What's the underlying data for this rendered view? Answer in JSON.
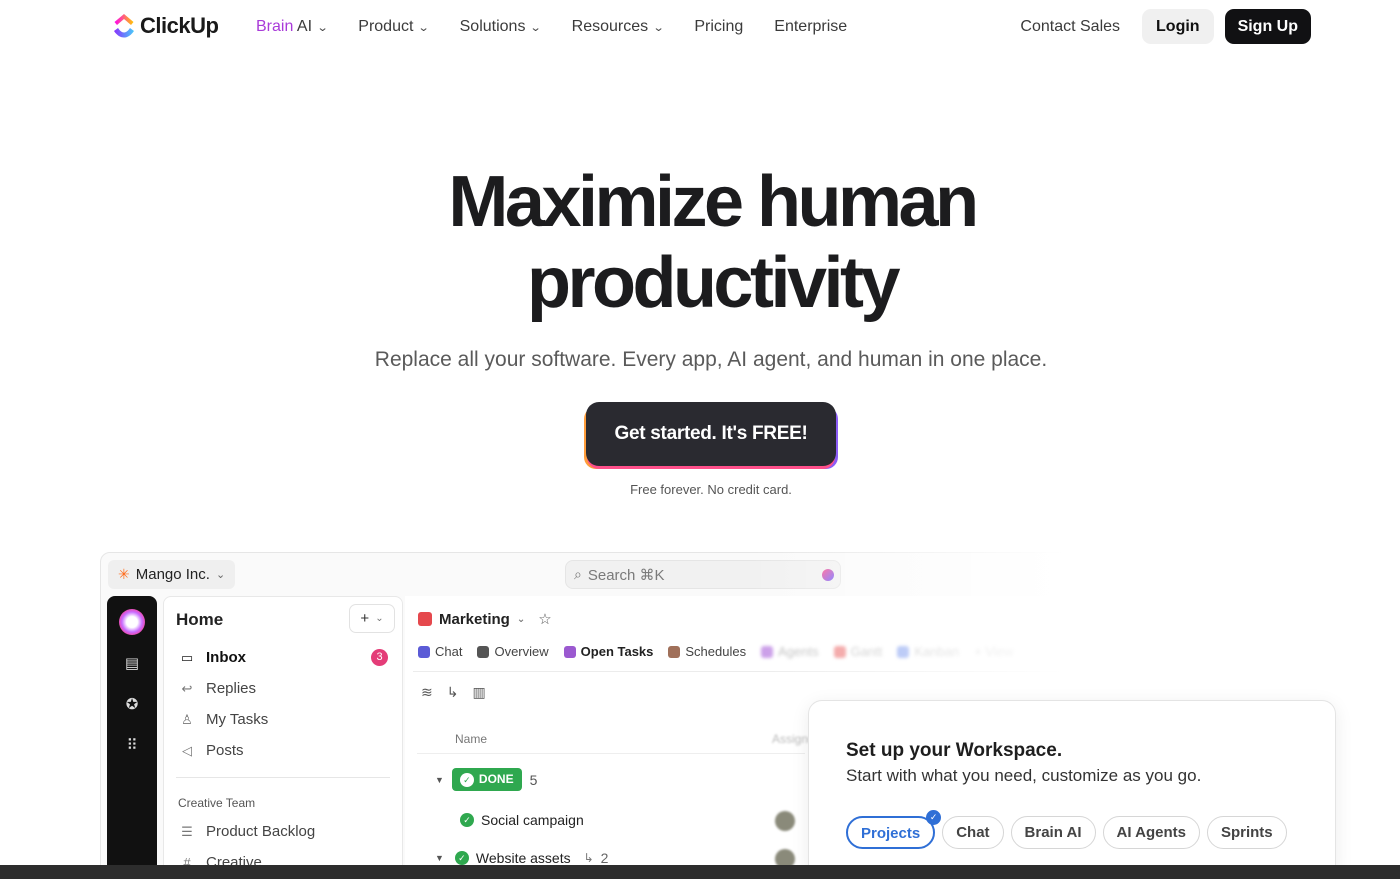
{
  "nav": {
    "brand": "ClickUp",
    "brain_b": "Brain",
    "brain_rest": " AI",
    "links": [
      "Product",
      "Solutions",
      "Resources",
      "Pricing",
      "Enterprise"
    ],
    "contact": "Contact Sales",
    "login": "Login",
    "signup": "Sign Up"
  },
  "hero": {
    "title_line1": "Maximize human",
    "title_line2": "productivity",
    "subtitle": "Replace all your software. Every app, AI agent, and human in one place.",
    "cta": "Get started. It's FREE!",
    "note": "Free forever. No credit card."
  },
  "app": {
    "workspace": "Mango Inc.",
    "search_placeholder": "Search ⌘K",
    "sidebar": {
      "home": "Home",
      "items": [
        {
          "label": "Inbox",
          "icon": "inbox-icon"
        },
        {
          "label": "Replies",
          "icon": "reply-icon"
        },
        {
          "label": "My Tasks",
          "icon": "user-icon"
        },
        {
          "label": "Posts",
          "icon": "megaphone-icon"
        }
      ],
      "inbox_count": "3",
      "section": "Creative Team",
      "section_items": [
        {
          "label": "Product Backlog",
          "icon": "checklist-icon"
        },
        {
          "label": "Creative",
          "icon": "hash-icon"
        }
      ]
    },
    "main": {
      "title": "Marketing",
      "tabs": [
        "Chat",
        "Overview",
        "Open Tasks",
        "Schedules",
        "Agents",
        "Gantt",
        "Kanban",
        "+ View"
      ],
      "col_name": "Name",
      "col_assignee": "Assignee",
      "status": "DONE",
      "status_count": "5",
      "tasks": [
        {
          "name": "Social campaign",
          "subtasks": ""
        },
        {
          "name": "Website assets",
          "subtasks": "2"
        }
      ]
    },
    "setup": {
      "title": "Set up your Workspace.",
      "subtitle": "Start with what you need, customize as you go.",
      "pills": [
        "Projects",
        "Chat",
        "Brain AI",
        "AI Agents",
        "Sprints"
      ]
    }
  },
  "colors": {
    "accent": "#7b68ee",
    "brain": "#a93bd9",
    "done": "#2fa84f",
    "select": "#2f6fd6"
  }
}
